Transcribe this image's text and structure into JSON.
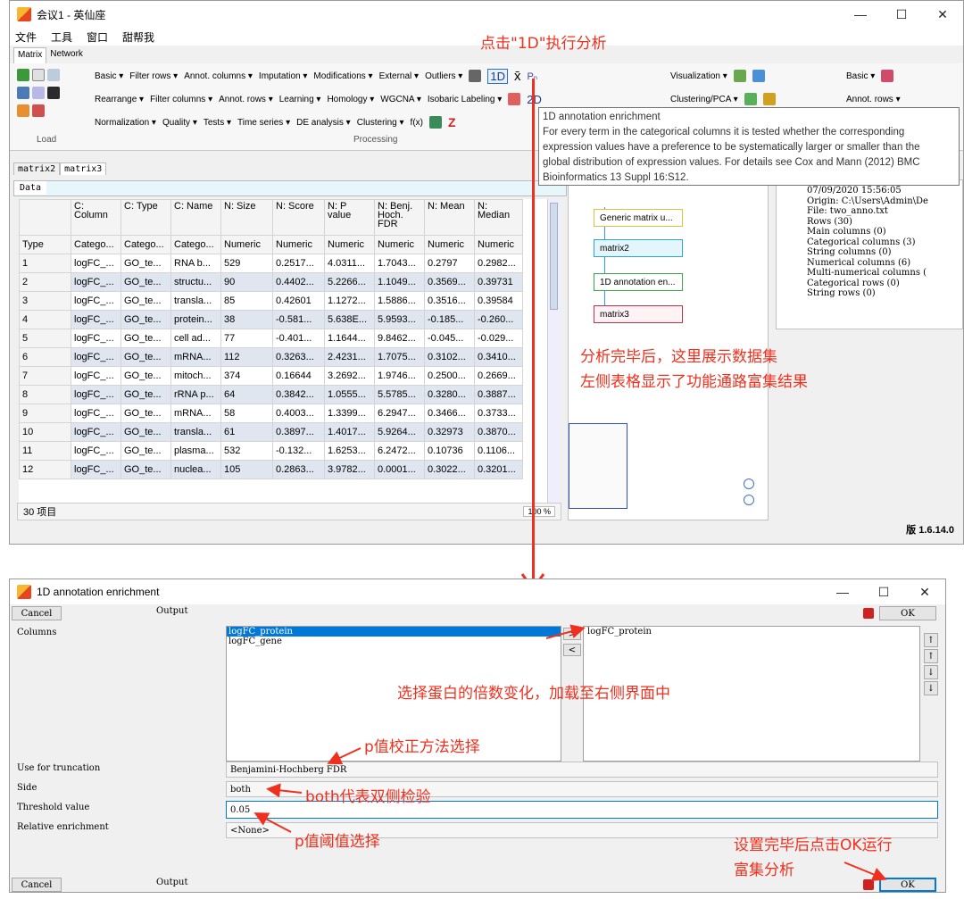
{
  "main_window": {
    "title": "会议1 - 英仙座",
    "controls": [
      "—",
      "☐",
      "✕"
    ],
    "menu": [
      "文件",
      "工具",
      "窗口",
      "甜帮我"
    ],
    "tabs": [
      "Matrix",
      "Network"
    ],
    "toolbar": {
      "row1": [
        "Basic ▾",
        "Filter rows ▾",
        "Annot. columns ▾",
        "Imputation ▾",
        "Modifications ▾",
        "External ▾",
        "Outliers ▾"
      ],
      "row2": [
        "Rearrange ▾",
        "Filter columns ▾",
        "Annot. rows ▾",
        "Learning ▾",
        "Homology ▾",
        "WGCNA ▾",
        "Isobaric Labeling ▾"
      ],
      "row3": [
        "Normalization ▾",
        "Quality ▾",
        "Tests ▾",
        "Time series ▾",
        "DE analysis ▾",
        "Clustering ▾",
        "f(x)"
      ],
      "oned_button": "1D",
      "twod_button": "2D",
      "xbar": "x̄",
      "pn": "Pₙ",
      "right_group": [
        "Visualization ▾",
        "Clustering/PCA ▾"
      ],
      "far_right": [
        "Basic ▾",
        "Annot. rows ▾"
      ],
      "load_label": "Load",
      "processing_label": "Processing"
    },
    "data_tabs": [
      "matrix2",
      "matrix3"
    ],
    "data_subtab": "Data",
    "table": {
      "headers": [
        "",
        "C:\nColumn",
        "C: Type",
        "C: Name",
        "N: Size",
        "N: Score",
        "N: P\nvalue",
        "N: Benj.\nHoch.\nFDR",
        "N: Mean",
        "N:\nMedian"
      ],
      "type_row": [
        "Type",
        "Catego...",
        "Catego...",
        "Catego...",
        "Numeric",
        "Numeric",
        "Numeric",
        "Numeric",
        "Numeric",
        "Numeric"
      ],
      "rows": [
        [
          "1",
          "logFC_...",
          "GO_te...",
          "RNA b...",
          "529",
          "0.2517...",
          "4.0311...",
          "1.7043...",
          "0.2797",
          "0.2982..."
        ],
        [
          "2",
          "logFC_...",
          "GO_te...",
          "structu...",
          "90",
          "0.4402...",
          "5.2266...",
          "1.1049...",
          "0.3569...",
          "0.39731"
        ],
        [
          "3",
          "logFC_...",
          "GO_te...",
          "transla...",
          "85",
          "0.42601",
          "1.1272...",
          "1.5886...",
          "0.3516...",
          "0.39584"
        ],
        [
          "4",
          "logFC_...",
          "GO_te...",
          "protein...",
          "38",
          "-0.581...",
          "5.638E...",
          "5.9593...",
          "-0.185...",
          "-0.260..."
        ],
        [
          "5",
          "logFC_...",
          "GO_te...",
          "cell ad...",
          "77",
          "-0.401...",
          "1.1644...",
          "9.8462...",
          "-0.045...",
          "-0.029..."
        ],
        [
          "6",
          "logFC_...",
          "GO_te...",
          "mRNA...",
          "112",
          "0.3263...",
          "2.4231...",
          "1.7075...",
          "0.3102...",
          "0.3410..."
        ],
        [
          "7",
          "logFC_...",
          "GO_te...",
          "mitoch...",
          "374",
          "0.16644",
          "3.2692...",
          "1.9746...",
          "0.2500...",
          "0.2669..."
        ],
        [
          "8",
          "logFC_...",
          "GO_te...",
          "rRNA p...",
          "64",
          "0.3842...",
          "1.0555...",
          "5.5785...",
          "0.3280...",
          "0.3887..."
        ],
        [
          "9",
          "logFC_...",
          "GO_te...",
          "mRNA...",
          "58",
          "0.4003...",
          "1.3399...",
          "6.2947...",
          "0.3466...",
          "0.3733..."
        ],
        [
          "10",
          "logFC_...",
          "GO_te...",
          "transla...",
          "61",
          "0.3897...",
          "1.4017...",
          "5.9264...",
          "0.32973",
          "0.3870..."
        ],
        [
          "11",
          "logFC_...",
          "GO_te...",
          "plasma...",
          "532",
          "-0.132...",
          "1.6253...",
          "6.2472...",
          "0.10736",
          "0.1106..."
        ],
        [
          "12",
          "logFC_...",
          "GO_te...",
          "nuclea...",
          "105",
          "0.2863...",
          "3.9782...",
          "0.0001...",
          "0.3022...",
          "0.3201..."
        ]
      ],
      "count_label": "30 项目",
      "zoom": "100 %"
    },
    "flow_nodes": [
      "Generic matrix u...",
      "matrix2",
      "1D annotation en...",
      "matrix3"
    ],
    "info_panel": [
      "07/09/2020 15:56:05",
      "Origin: C:\\Users\\Admin\\De",
      "File: two_anno.txt",
      "Rows (30)",
      "Main columns (0)",
      "Categorical columns (3)",
      "String columns (0)",
      "Numerical columns (6)",
      "Multi-numerical columns (",
      "Categorical rows (0)",
      "String rows (0)"
    ],
    "version": "版 1.6.14.0"
  },
  "tooltip": {
    "title": "1D annotation enrichment",
    "body": [
      "For every term in the categorical columns it is tested whether the corresponding",
      "expression values have a preference to be systematically larger or smaller than the",
      "global distribution of expression values. For details see Cox and Mann (2012) BMC",
      "Bioinformatics 13 Suppl 16:S12."
    ]
  },
  "annotations": {
    "click_1d": "点击\"1D\"执行分析",
    "after_analysis_1": "分析完毕后，这里展示数据集",
    "after_analysis_2": "左侧表格显示了功能通路富集结果",
    "select_fc": "选择蛋白的倍数变化，加载至右侧界面中",
    "p_correction": "p值校正方法选择",
    "both_note": "both代表双侧检验",
    "p_threshold": "p值阈值选择",
    "ok_note_1": "设置完毕后点击OK运行",
    "ok_note_2": "富集分析"
  },
  "dialog": {
    "title": "1D annotation enrichment",
    "controls": [
      "—",
      "☐",
      "✕"
    ],
    "cancel": "Cancel",
    "output": "Output",
    "ok": "OK",
    "columns_label": "Columns",
    "available": [
      "logFC_protein",
      "logFC_gene"
    ],
    "selected": [
      "logFC_protein"
    ],
    "move_right": ">",
    "move_left": "<",
    "order_buttons": [
      "↑",
      "↑",
      "↓",
      "↓"
    ],
    "truncation_label": "Use for truncation",
    "truncation_value": "Benjamini-Hochberg FDR",
    "side_label": "Side",
    "side_value": "both",
    "threshold_label": "Threshold value",
    "threshold_value": "0.05",
    "relative_label": "Relative enrichment",
    "relative_value": "<None>"
  },
  "colors": {
    "annotation_red": "#f0301e",
    "selection_blue": "#0078d7",
    "node_border": "#2aa6d6"
  }
}
